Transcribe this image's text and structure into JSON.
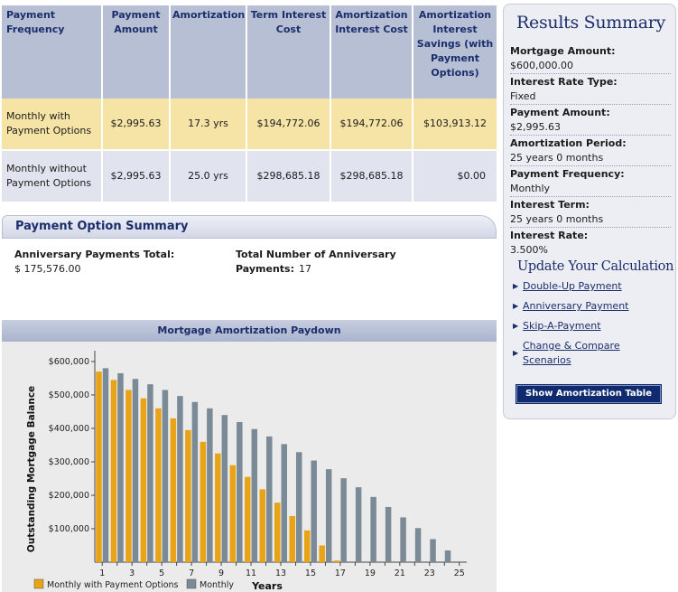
{
  "comparison_table": {
    "headers": [
      "Payment Frequency",
      "Payment Amount",
      "Amortization",
      "Term Interest Cost",
      "Amortization Interest Cost",
      "Amortization Interest Savings (with Payment Options)"
    ],
    "rows": [
      [
        "Monthly with Payment Options",
        "$2,995.63",
        "17.3 yrs",
        "$194,772.06",
        "$194,772.06",
        "$103,913.12"
      ],
      [
        "Monthly without Payment Options",
        "$2,995.63",
        "25.0 yrs",
        "$298,685.18",
        "$298,685.18",
        "$0.00"
      ]
    ]
  },
  "payment_option_summary": {
    "title": "Payment Option Summary",
    "anniversary_total_label": "Anniversary Payments Total:",
    "anniversary_total_value": "$ 175,576.00",
    "anniversary_count_label": "Total Number of Anniversary Payments:",
    "anniversary_count_value": "17"
  },
  "results_summary": {
    "title": "Results Summary",
    "items": [
      {
        "label": "Mortgage Amount:",
        "value": "$600,000.00"
      },
      {
        "label": "Interest Rate Type:",
        "value": "Fixed"
      },
      {
        "label": "Payment Amount:",
        "value": "$2,995.63"
      },
      {
        "label": "Amortization Period:",
        "value": "25 years 0 months"
      },
      {
        "label": "Payment Frequency:",
        "value": "Monthly"
      },
      {
        "label": "Interest Term:",
        "value": "25 years 0 months"
      },
      {
        "label": "Interest Rate:",
        "value": "3.500%"
      }
    ],
    "update_title": "Update Your Calculation",
    "links": [
      "Double-Up Payment",
      "Anniversary Payment",
      "Skip-A-Payment",
      "Change & Compare Scenarios"
    ],
    "button_label": "Show Amortization Table"
  },
  "chart_data": {
    "type": "bar",
    "title": "Mortgage Amortization Paydown",
    "xlabel": "Years",
    "ylabel": "Outstanding Mortgage Balance",
    "x": [
      1,
      2,
      3,
      4,
      5,
      6,
      7,
      8,
      9,
      10,
      11,
      12,
      13,
      14,
      15,
      16,
      17,
      18,
      19,
      20,
      21,
      22,
      23,
      24,
      25
    ],
    "x_tick_labels": [
      "1",
      "3",
      "5",
      "7",
      "9",
      "11",
      "13",
      "15",
      "17",
      "19",
      "21",
      "23",
      "25"
    ],
    "y_tick_labels": [
      "$100,000",
      "$200,000",
      "$300,000",
      "$400,000",
      "$500,000",
      "$600,000"
    ],
    "ylim": [
      0,
      600000
    ],
    "grid": false,
    "legend_position": "bottom-left",
    "series": [
      {
        "name": "Monthly with Payment Options",
        "color": "#e8a317",
        "values": [
          570000,
          545000,
          515000,
          490000,
          460000,
          430000,
          395000,
          360000,
          325000,
          290000,
          255000,
          218000,
          178000,
          138000,
          95000,
          50000,
          5000,
          0,
          0,
          0,
          0,
          0,
          0,
          0,
          0
        ]
      },
      {
        "name": "Monthly",
        "color": "#7b8a97",
        "values": [
          580000,
          565000,
          548000,
          532000,
          515000,
          497000,
          479000,
          460000,
          440000,
          419000,
          398000,
          376000,
          353000,
          329000,
          304000,
          278000,
          251000,
          224000,
          195000,
          165000,
          134000,
          102000,
          69000,
          35000,
          0
        ]
      }
    ]
  }
}
